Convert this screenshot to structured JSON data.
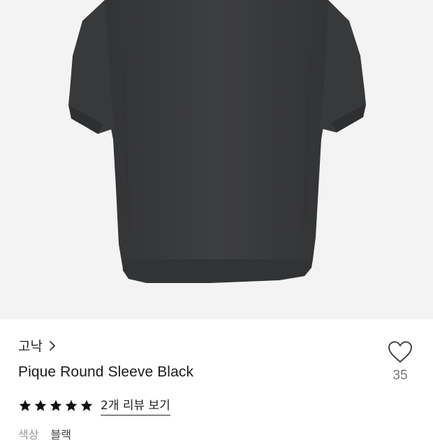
{
  "product": {
    "brand": "고낙",
    "title": "Pique Round Sleeve Black",
    "like_count": "35",
    "rating": 5,
    "review_link": "2개 리뷰 보기",
    "next_row_label": "색상",
    "next_row_value": "블랙"
  },
  "icons": {
    "brand_chevron": "chevron-right-icon",
    "like": "heart-outline-icon",
    "rating": "star-filled-icon"
  },
  "colors": {
    "garment": "#3b3c3e",
    "photo_bg": "#f3f3f3",
    "text": "#1b1b1b",
    "muted": "#777777"
  }
}
